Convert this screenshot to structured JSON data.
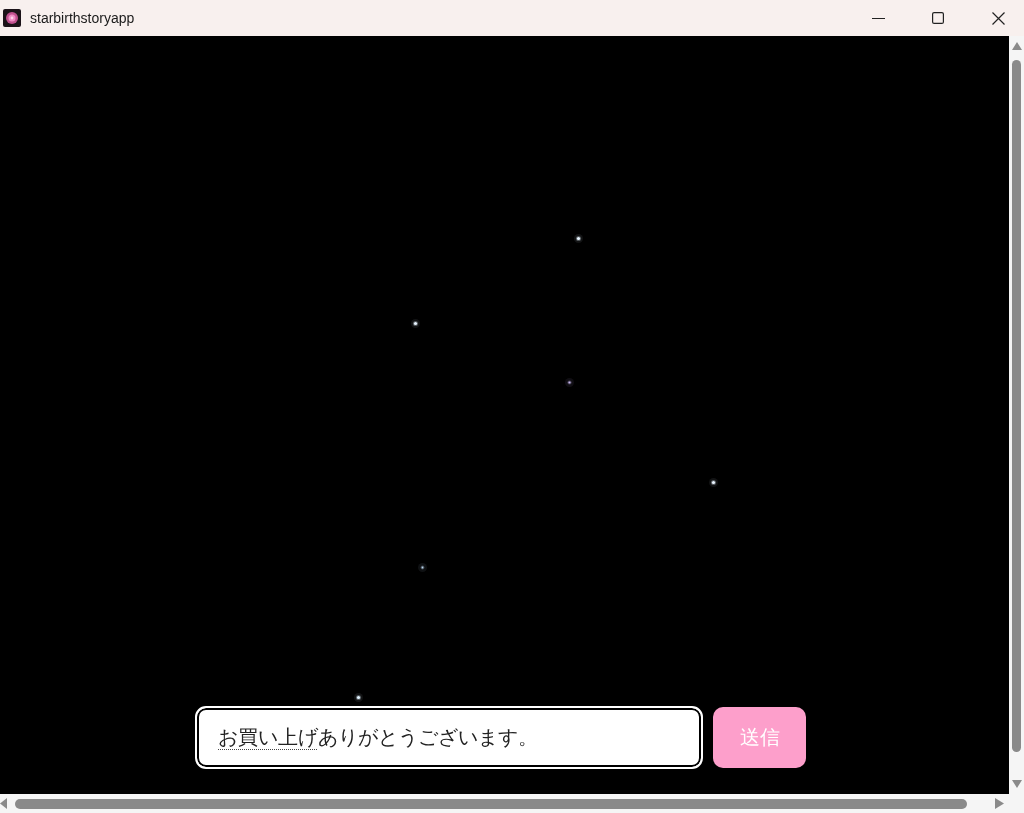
{
  "window": {
    "title": "starbirthstoryapp"
  },
  "message_field": {
    "value_segments": [
      {
        "text": "お買い上げ",
        "composing": true
      },
      {
        "text": "ありがとうございます。",
        "composing": false
      }
    ]
  },
  "send_button": {
    "label": "送信"
  }
}
